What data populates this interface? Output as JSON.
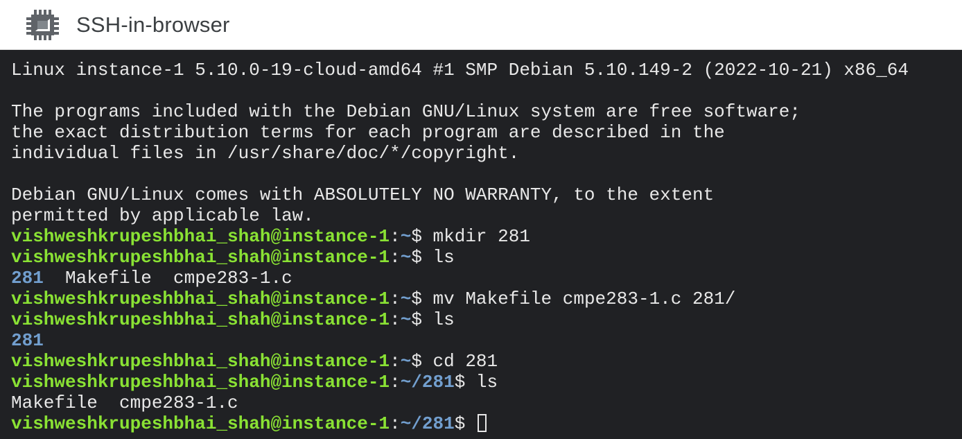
{
  "header": {
    "title": "SSH-in-browser",
    "icon": "chip-icon"
  },
  "colors": {
    "prompt_user": "#8ae234",
    "prompt_path": "#729fcf",
    "directory": "#729fcf",
    "text": "#e8e8e8",
    "background": "#202124"
  },
  "terminal": {
    "banner": [
      "Linux instance-1 5.10.0-19-cloud-amd64 #1 SMP Debian 5.10.149-2 (2022-10-21) x86_64",
      "",
      "The programs included with the Debian GNU/Linux system are free software;",
      "the exact distribution terms for each program are described in the",
      "individual files in /usr/share/doc/*/copyright.",
      "",
      "Debian GNU/Linux comes with ABSOLUTELY NO WARRANTY, to the extent",
      "permitted by applicable law."
    ],
    "prompt_user": "vishweshkrupeshbhai_shah@instance-1",
    "sep": ":",
    "p1": {
      "path": "~",
      "cmd": "$ mkdir 281"
    },
    "p2": {
      "path": "~",
      "cmd": "$ ls"
    },
    "out1": {
      "dir": "281",
      "files": "  Makefile  cmpe283-1.c"
    },
    "p3": {
      "path": "~",
      "cmd": "$ mv Makefile cmpe283-1.c 281/"
    },
    "p4": {
      "path": "~",
      "cmd": "$ ls"
    },
    "out2": {
      "dir": "281"
    },
    "p5": {
      "path": "~",
      "cmd": "$ cd 281"
    },
    "p6": {
      "path": "~/281",
      "cmd": "$ ls"
    },
    "out3": "Makefile  cmpe283-1.c",
    "p7": {
      "path": "~/281",
      "cmd": "$ "
    }
  }
}
